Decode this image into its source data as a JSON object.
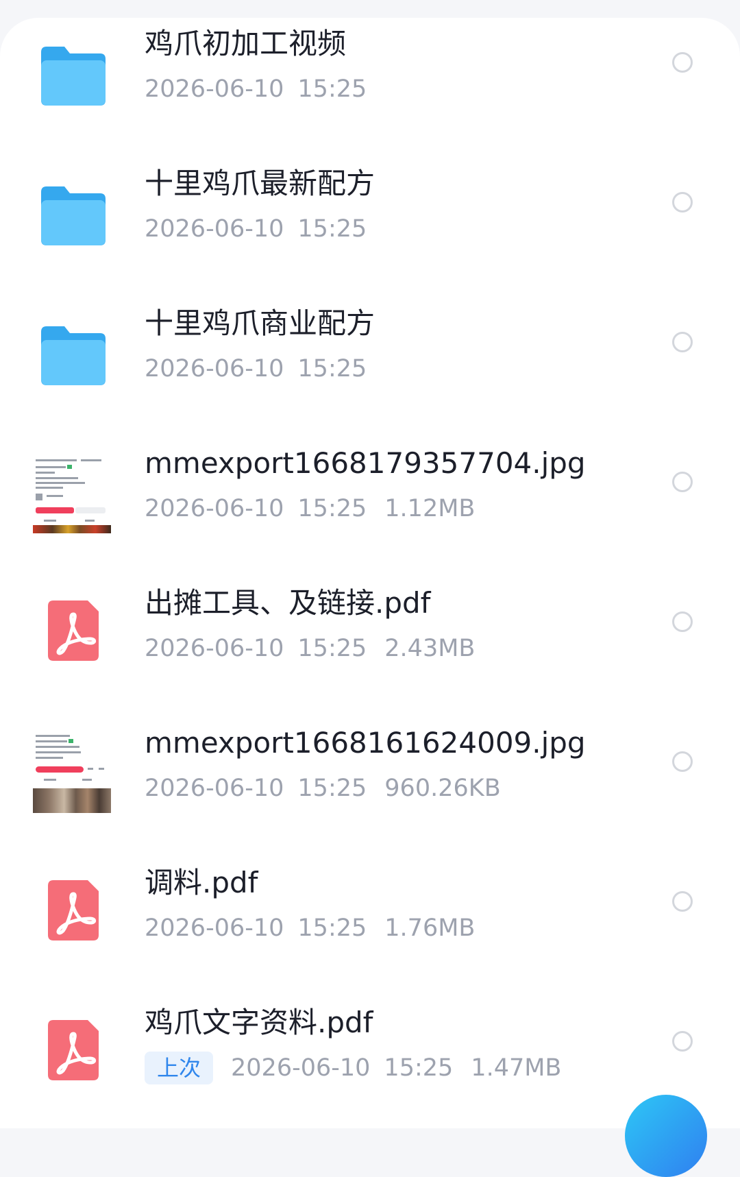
{
  "files": [
    {
      "name": "鸡爪初加工视频",
      "date": "2026-06-10",
      "time": "15:25",
      "size": "",
      "tag": "",
      "type": "folder",
      "icon": "folder-icon"
    },
    {
      "name": "十里鸡爪最新配方",
      "date": "2026-06-10",
      "time": "15:25",
      "size": "",
      "tag": "",
      "type": "folder",
      "icon": "folder-icon"
    },
    {
      "name": "十里鸡爪商业配方",
      "date": "2026-06-10",
      "time": "15:25",
      "size": "",
      "tag": "",
      "type": "folder",
      "icon": "folder-icon"
    },
    {
      "name": "mmexport1668179357704.jpg",
      "date": "2026-06-10",
      "time": "15:25",
      "size": "1.12MB",
      "tag": "",
      "type": "image",
      "icon": "image-thumbnail"
    },
    {
      "name": "出摊工具、及链接.pdf",
      "date": "2026-06-10",
      "time": "15:25",
      "size": "2.43MB",
      "tag": "",
      "type": "pdf",
      "icon": "pdf-icon"
    },
    {
      "name": "mmexport1668161624009.jpg",
      "date": "2026-06-10",
      "time": "15:25",
      "size": "960.26KB",
      "tag": "",
      "type": "image",
      "icon": "image-thumbnail"
    },
    {
      "name": "调料.pdf",
      "date": "2026-06-10",
      "time": "15:25",
      "size": "1.76MB",
      "tag": "",
      "type": "pdf",
      "icon": "pdf-icon"
    },
    {
      "name": "鸡爪文字资料.pdf",
      "date": "2026-06-10",
      "time": "15:25",
      "size": "1.47MB",
      "tag": "上次",
      "type": "pdf",
      "icon": "pdf-icon"
    }
  ],
  "colors": {
    "folder": "#2fb4f2",
    "pdf": "#f56d78",
    "tag_bg": "#e9f2fd",
    "tag_text": "#2f86ec",
    "meta_text": "#9da2ae"
  }
}
